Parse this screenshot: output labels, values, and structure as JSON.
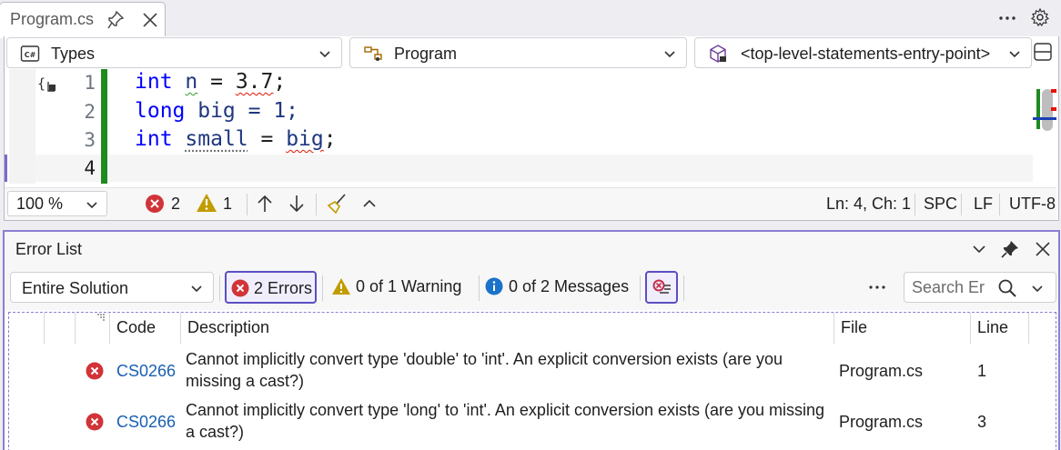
{
  "editor": {
    "tab_title": "Program.cs",
    "nav": {
      "types_label": "Types",
      "program_label": "Program",
      "member_label": "<top-level-statements-entry-point>"
    },
    "line_numbers": [
      "1",
      "2",
      "3",
      "4"
    ],
    "code": {
      "l1": {
        "kw": "int",
        "var": "n",
        "eq": " = ",
        "val": "3.7",
        "end": ";"
      },
      "l2": {
        "kw": "long",
        "rest": " big = 1;"
      },
      "l3": {
        "kw": "int",
        "var": "small",
        "eq": " = ",
        "val": "big",
        "end": ";"
      }
    },
    "status": {
      "zoom": "100 %",
      "error_count": "2",
      "warning_count": "1",
      "position": "Ln: 4, Ch: 1",
      "indent": "SPC",
      "line_ending": "LF",
      "encoding": "UTF-8"
    }
  },
  "error_list": {
    "title": "Error List",
    "scope": "Entire Solution",
    "filters": {
      "errors": "2 Errors",
      "warnings": "0 of 1 Warning",
      "messages": "0 of 2 Messages"
    },
    "search_placeholder": "Search Error List",
    "columns": {
      "code": "Code",
      "description": "Description",
      "file": "File",
      "line": "Line"
    },
    "rows": [
      {
        "code": "CS0266",
        "desc1": "Cannot implicitly convert type 'double' to 'int'. An explicit conversion exists (are you",
        "desc2": "missing a cast?)",
        "file": "Program.cs",
        "line": "1"
      },
      {
        "code": "CS0266",
        "desc1": "Cannot implicitly convert type 'long' to 'int'. An explicit conversion exists (are you missing",
        "desc2": "a cast?)",
        "file": "Program.cs",
        "line": "3"
      }
    ]
  },
  "colors": {
    "accent": "#5b4fc2",
    "error": "#d13438",
    "warning": "#c19c00",
    "info": "#1a73c8",
    "change_bar": "#1f8a1f"
  },
  "icons": [
    "pin-icon",
    "close-icon",
    "more-icon",
    "gear-icon",
    "csharp-icon",
    "class-icon",
    "member-icon",
    "chevron-down-icon",
    "split-icon",
    "error-icon",
    "warning-icon",
    "info-icon",
    "arrow-up-icon",
    "arrow-down-icon",
    "broom-icon",
    "chevron-up-icon",
    "search-icon",
    "filter-icon"
  ]
}
